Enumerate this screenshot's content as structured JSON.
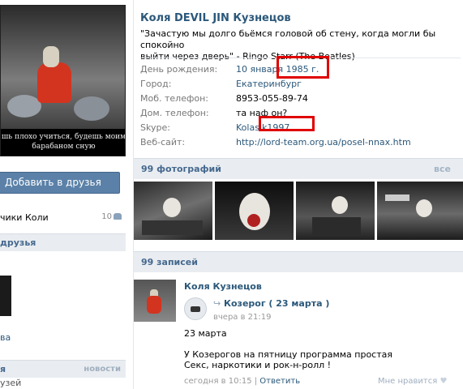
{
  "profile": {
    "name": "Коля DEVIL JIN Кузнецов",
    "status_line1": "\"Зачастую мы долго бьёмся головой об стену, когда могли бы спокойно",
    "status_line2": "выйти через дверь\" - Ringo Starr (The Beatles)"
  },
  "avatar": {
    "caption_line1": "шь плохо учиться, будешь моим",
    "caption_line2": "барабаном сную"
  },
  "info": [
    {
      "label": "День рождения:",
      "value": "10 января 1985 г."
    },
    {
      "label": "Город:",
      "value": "Екатеринбург"
    },
    {
      "label": "Моб. телефон:",
      "value": "8953-055-89-74"
    },
    {
      "label": "Дом. телефон:",
      "value": "та наф он?"
    },
    {
      "label": "Skype:",
      "value": "Kolasik1997"
    },
    {
      "label": "Веб-сайт:",
      "value": "http://lord-team.org.ua/posel-nnax.htm"
    }
  ],
  "left": {
    "add_friend": "Добавить в друзья",
    "friends_label": "чики Коли",
    "friends_count": "10",
    "section_friends": "друзья",
    "friend_name": "ва",
    "section_bottom": "я",
    "section_bottom_right": "новости",
    "bottom_text": "узей"
  },
  "photos": {
    "header": "99 фотографий",
    "all": "все"
  },
  "wall": {
    "header": "99 записей",
    "author": "Коля Кузнецов",
    "repost_arrow": "↪",
    "repost_title": "Козерог ( 23 марта )",
    "repost_time": "вчера в 21:19",
    "text_line1": "23 марта",
    "text_line2": "У Козерогов на пятницу программа простая",
    "text_line3": "Секс, наркотики и рок-н-ролл !",
    "meta_time": "сегодня в 10:15",
    "meta_sep": " | ",
    "reply": "Ответить",
    "like": "Мне нравится",
    "heart": "♥"
  },
  "colors": {
    "link": "#2b587a",
    "header_bg": "#e9edf1",
    "highlight": "#e00000",
    "button": "#5b81a8"
  }
}
